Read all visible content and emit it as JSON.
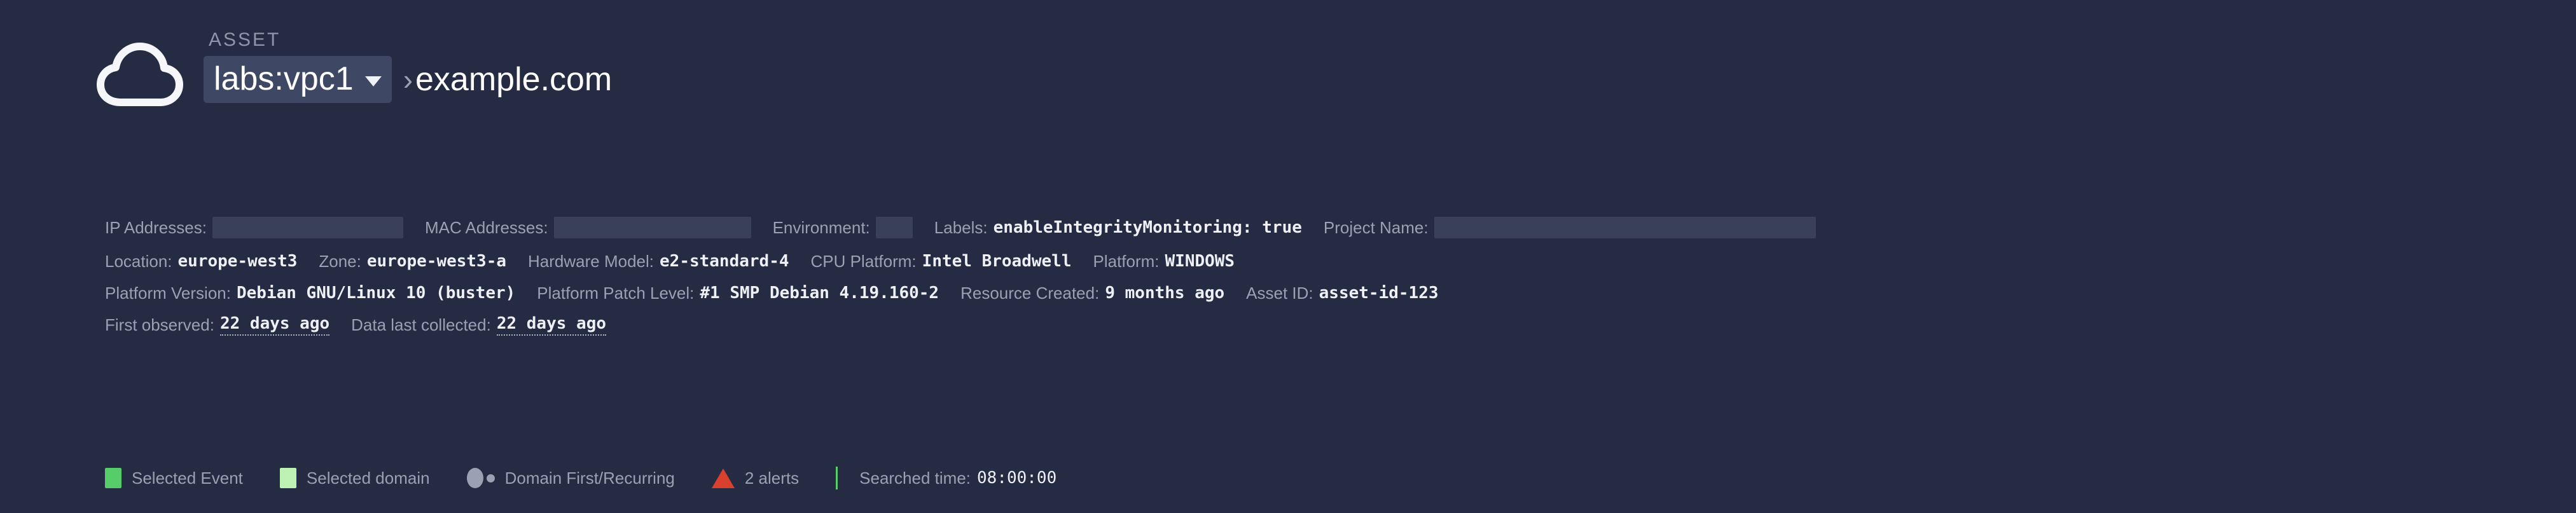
{
  "colors": {
    "background": "#242b42",
    "dropdown_bg": "#3e4764",
    "redaction": "#39415a",
    "label_text": "#9aa1b3",
    "value_text": "#eef0f5",
    "selected_event_green": "#56cc6a",
    "selected_domain_green": "#bdf2b4",
    "alert_red": "#d9412e",
    "divider_green": "#58d06b"
  },
  "header": {
    "icon": "cloud-icon",
    "asset_label": "ASSET",
    "asset_selector_value": "labs:vpc1",
    "caret_icon": "chevron-down-icon",
    "separator": "›",
    "domain_name": "example.com"
  },
  "meta": {
    "rows": [
      [
        {
          "key": "IP Addresses:",
          "value": null,
          "redacted": true,
          "redact_class": "ip"
        },
        {
          "key": "MAC Addresses:",
          "value": null,
          "redacted": true,
          "redact_class": "mac"
        },
        {
          "key": "Environment:",
          "value": null,
          "redacted": true,
          "redact_class": "env"
        },
        {
          "key": "Labels:",
          "value": "enableIntegrityMonitoring: true",
          "redacted": false
        },
        {
          "key": "Project Name:",
          "value": null,
          "redacted": true,
          "redact_class": "proj"
        }
      ],
      [
        {
          "key": "Location:",
          "value": "europe-west3"
        },
        {
          "key": "Zone:",
          "value": "europe-west3-a"
        },
        {
          "key": "Hardware Model:",
          "value": "e2-standard-4"
        },
        {
          "key": "CPU Platform:",
          "value": "Intel Broadwell"
        },
        {
          "key": "Platform:",
          "value": "WINDOWS"
        }
      ],
      [
        {
          "key": "Platform Version:",
          "value": "Debian GNU/Linux 10 (buster)"
        },
        {
          "key": "Platform Patch Level:",
          "value": "#1 SMP Debian 4.19.160-2"
        },
        {
          "key": "Resource Created:",
          "value": "9 months ago"
        },
        {
          "key": "Asset ID:",
          "value": "asset-id-123"
        }
      ],
      [
        {
          "key": "First observed:",
          "value": "22 days ago",
          "dotted": true
        },
        {
          "key": "Data last collected:",
          "value": "22 days ago",
          "dotted": true
        }
      ]
    ]
  },
  "legend": {
    "items": [
      {
        "marker": "green-square-swatch",
        "label": "Selected Event"
      },
      {
        "marker": "light-green-square-swatch",
        "label": "Selected domain"
      },
      {
        "marker": "gray-circles-marker",
        "label": "Domain First/Recurring"
      },
      {
        "marker": "red-triangle-alert-icon",
        "label": "2 alerts"
      }
    ],
    "searched_time_key": "Searched time:",
    "searched_time_value": "08:00:00"
  }
}
